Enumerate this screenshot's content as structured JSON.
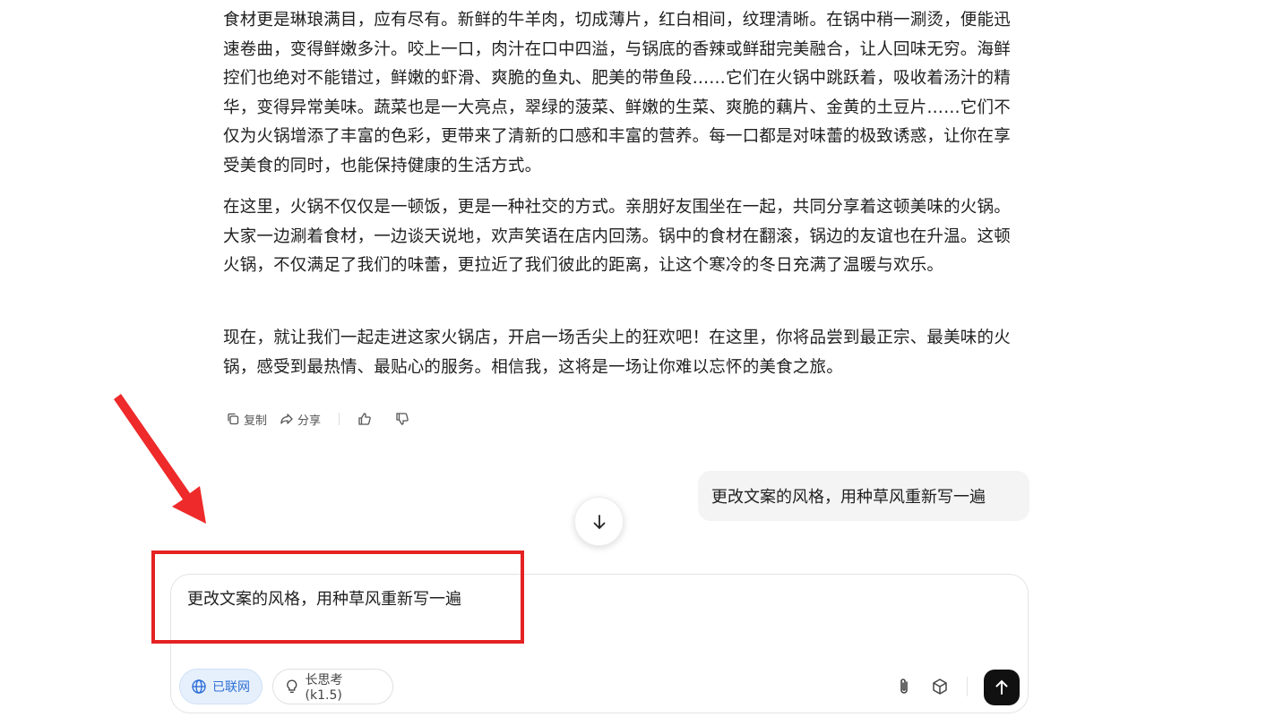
{
  "message": {
    "paragraphs": [
      "食材更是琳琅满目，应有尽有。新鲜的牛羊肉，切成薄片，红白相间，纹理清晰。在锅中稍一涮烫，便能迅速卷曲，变得鲜嫩多汁。咬上一口，肉汁在口中四溢，与锅底的香辣或鲜甜完美融合，让人回味无穷。海鲜控们也绝对不能错过，鲜嫩的虾滑、爽脆的鱼丸、肥美的带鱼段……它们在火锅中跳跃着，吸收着汤汁的精华，变得异常美味。蔬菜也是一大亮点，翠绿的菠菜、鲜嫩的生菜、爽脆的藕片、金黄的土豆片……它们不仅为火锅增添了丰富的色彩，更带来了清新的口感和丰富的营养。每一口都是对味蕾的极致诱惑，让你在享受美食的同时，也能保持健康的生活方式。",
      "在这里，火锅不仅仅是一顿饭，更是一种社交的方式。亲朋好友围坐在一起，共同分享着这顿美味的火锅。大家一边涮着食材，一边谈天说地，欢声笑语在店内回荡。锅中的食材在翻滚，锅边的友谊也在升温。这顿火锅，不仅满足了我们的味蕾，更拉近了我们彼此的距离，让这个寒冷的冬日充满了温暖与欢乐。",
      "现在，就让我们一起走进这家火锅店，开启一场舌尖上的狂欢吧！在这里，你将品尝到最正宗、最美味的火锅，感受到最热情、最贴心的服务。相信我，这将是一场让你难以忘怀的美食之旅。"
    ],
    "actions": {
      "copy": "复制",
      "share": "分享"
    }
  },
  "user_message": "更改文案的风格，用种草风重新写一遍",
  "composer": {
    "value": "更改文案的风格，用种草风重新写一遍",
    "web_chip": "已联网",
    "think_chip": "长思考 (k1.5)"
  },
  "colors": {
    "accent": "#2f6fd6",
    "annotation": "#e52222",
    "send_button": "#111111"
  },
  "icons": [
    "copy-icon",
    "share-icon",
    "thumbs-up-icon",
    "thumbs-down-icon",
    "arrow-down-icon",
    "globe-icon",
    "lightbulb-icon",
    "paperclip-icon",
    "cube-icon",
    "arrow-up-icon"
  ]
}
